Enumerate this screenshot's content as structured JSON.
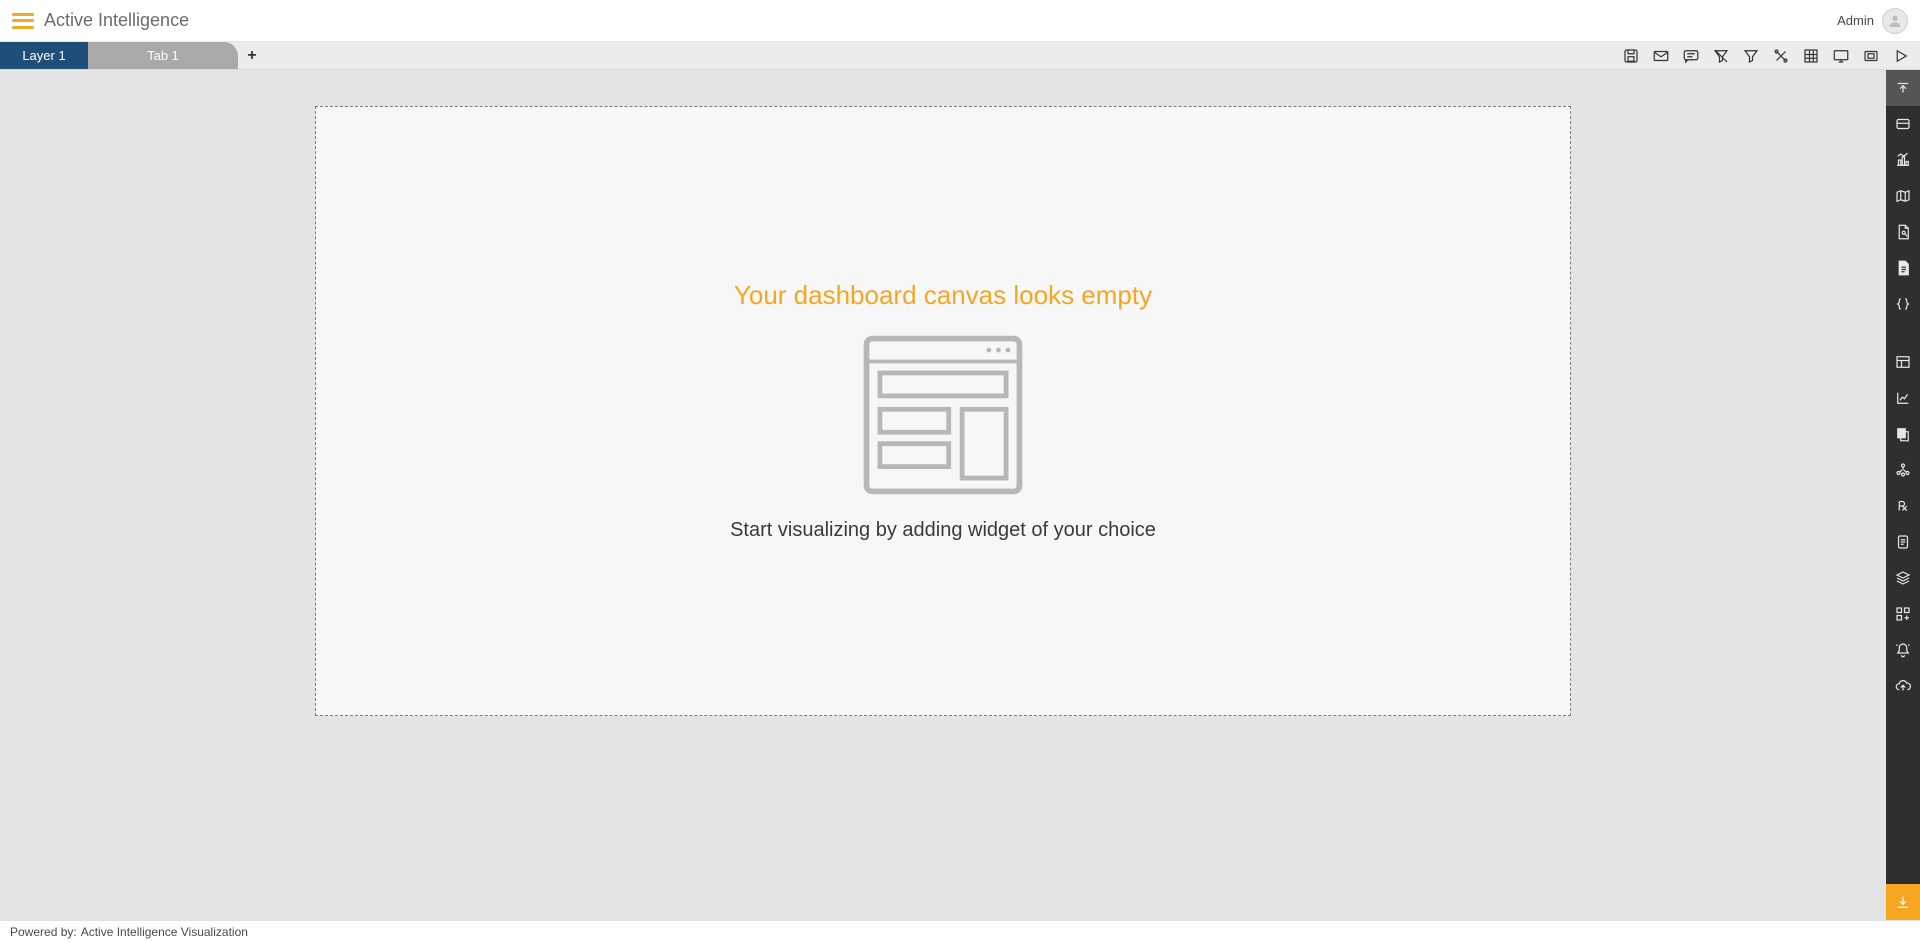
{
  "header": {
    "app_title": "Active Intelligence",
    "user_label": "Admin"
  },
  "tabs": {
    "layer_label": "Layer 1",
    "items": [
      {
        "label": "Tab 1"
      }
    ]
  },
  "toolbar_icons": [
    "save-icon",
    "mail-icon",
    "comment-icon",
    "clear-filter-icon",
    "filter-icon",
    "tools-icon",
    "grid-icon",
    "device-icon",
    "fit-icon",
    "play-icon"
  ],
  "canvas": {
    "empty_title": "Your dashboard canvas looks empty",
    "empty_subtitle": "Start visualizing by adding widget of your choice"
  },
  "siderail_icons": [
    "collapse-icon",
    "card-widget-icon",
    "chart-widget-icon",
    "map-widget-icon",
    "report-widget-icon",
    "document-widget-icon",
    "code-widget-icon",
    "table-widget-icon",
    "axis-widget-icon",
    "copy-widget-icon",
    "network-widget-icon",
    "rx-widget-icon",
    "form-widget-icon",
    "layers-widget-icon",
    "components-widget-icon",
    "alert-widget-icon",
    "cloud-upload-icon",
    "download-icon"
  ],
  "footer": {
    "powered_label": "Powered by:",
    "powered_value": "Active Intelligence Visualization"
  },
  "colors": {
    "accent": "#f5a623",
    "primary_tab": "#1f4e79",
    "rail_bg": "#2f2f2f"
  }
}
